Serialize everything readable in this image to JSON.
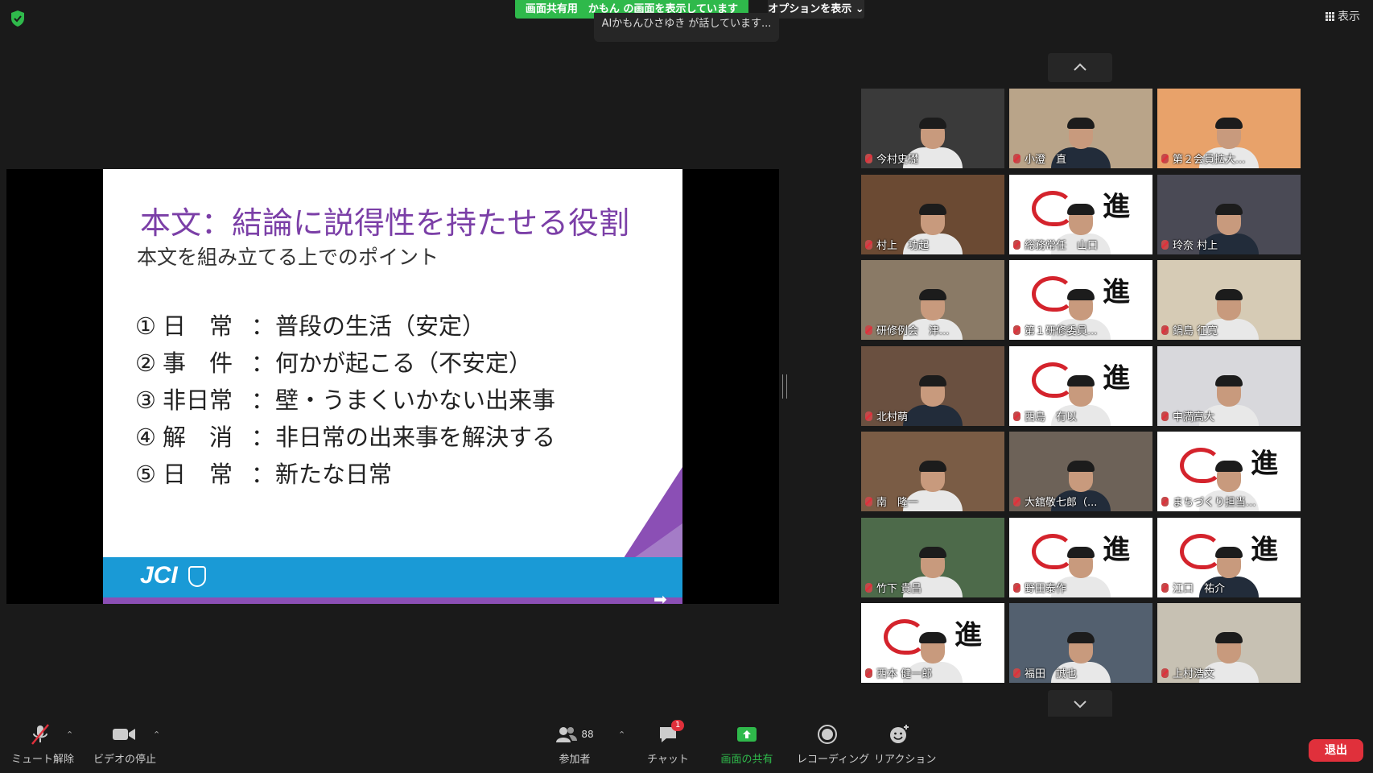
{
  "top": {
    "share_banner": "画面共有用　かもん の画面を表示しています",
    "options_label": "オプションを表示 ⌄",
    "talking_tip": "AIかもんひさゆき が話しています...",
    "view_label": "表示"
  },
  "slide": {
    "title": "本文：結論に説得性を持たせる役割",
    "subtitle": "本文を組み立てる上でのポイント",
    "points": [
      {
        "num": "①",
        "term": "日　常",
        "sep": "：",
        "desc": "普段の生活（安定）"
      },
      {
        "num": "②",
        "term": "事　件",
        "sep": "：",
        "desc": "何かが起こる（不安定）"
      },
      {
        "num": "③",
        "term": "非日常",
        "sep": "：",
        "desc": "壁・うまくいかない出来事"
      },
      {
        "num": "④",
        "term": "解　消",
        "sep": "：",
        "desc": "非日常の出来事を解決する"
      },
      {
        "num": "⑤",
        "term": "日　常",
        "sep": "：",
        "desc": "新たな日常"
      }
    ],
    "logo_text": "JCI",
    "next_arrow": "➡"
  },
  "gallery": {
    "participants": [
      {
        "name": "今村史礎",
        "bg": "#3a3a3a"
      },
      {
        "name": "小澄　直",
        "bg": "#b9a489"
      },
      {
        "name": "第２会員拡大...",
        "bg": "#e8a26a"
      },
      {
        "name": "村上　功起",
        "bg": "#6b4a33"
      },
      {
        "name": "総務常任　山口",
        "bg": "logo"
      },
      {
        "name": "玲奈 村上",
        "bg": "#4a4a55"
      },
      {
        "name": "研修例会　津...",
        "bg": "#8a7a66"
      },
      {
        "name": "第１研修委員...",
        "bg": "logo"
      },
      {
        "name": "鍋島 征寛",
        "bg": "#d6cbb5"
      },
      {
        "name": "北村萌",
        "bg": "#6a5040"
      },
      {
        "name": "西島　有以",
        "bg": "logo"
      },
      {
        "name": "中満高大",
        "bg": "#d8d8dc"
      },
      {
        "name": "南　隆一",
        "bg": "#7a5c45"
      },
      {
        "name": "大舘敬七郎（...",
        "bg": "#6d6258"
      },
      {
        "name": "まちづくり担当...",
        "bg": "logo"
      },
      {
        "name": "竹下 貴昌",
        "bg": "#4d6a4a"
      },
      {
        "name": "野田泰作",
        "bg": "logo"
      },
      {
        "name": "江口　祐介",
        "bg": "logo"
      },
      {
        "name": "西本 健一郎",
        "bg": "logo"
      },
      {
        "name": "福田　誠也",
        "bg": "#53606f"
      },
      {
        "name": "上村浩文",
        "bg": "#c7c1b3"
      }
    ],
    "logo_char": "進"
  },
  "toolbar": {
    "mute": "ミュート解除",
    "video": "ビデオの停止",
    "participants": "参加者",
    "participants_count": "88",
    "chat": "チャット",
    "chat_badge": "1",
    "share": "画面の共有",
    "record": "レコーディング",
    "reaction": "リアクション",
    "leave": "退出"
  }
}
